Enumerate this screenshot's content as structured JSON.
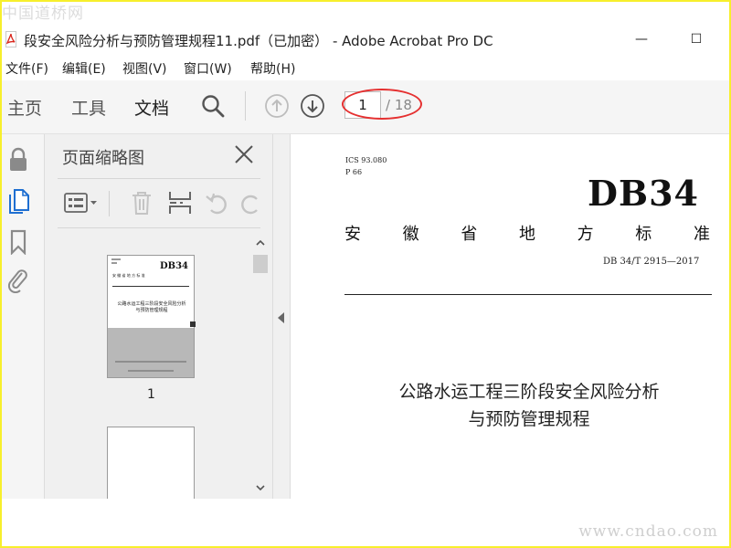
{
  "watermark": {
    "top": "中国道桥网",
    "bottom": "www.cndao.com"
  },
  "window": {
    "title": "段安全风险分析与预防管理规程11.pdf（已加密） - Adobe Acrobat Pro DC",
    "minimize": "—",
    "maximize": "☐"
  },
  "menu": [
    "文件(F)",
    "编辑(E)",
    "视图(V)",
    "窗口(W)",
    "帮助(H)"
  ],
  "toolbar": {
    "tabs": [
      "主页",
      "工具",
      "文档"
    ],
    "page_current": "1",
    "page_total": "/ 18"
  },
  "colors": {
    "annotation": "#e53030",
    "acrobat_red": "#d9261c",
    "nav_blue": "#1f6fd1"
  },
  "panel": {
    "title": "页面缩略图",
    "thumbnail_label": "1",
    "thumb": {
      "code": "DB34",
      "subtitle": "安 徽 省 地 方 标 准",
      "title_line1": "公路水运工程三阶段安全风险分析",
      "title_line2": "与预防管理规程"
    }
  },
  "document": {
    "ics": "ICS 93.080",
    "p": "P 66",
    "code": "DB34",
    "subtitle_chars": [
      "安",
      "徽",
      "省",
      "地",
      "方",
      "标",
      "准"
    ],
    "std_no": "DB 34/T 2915—2017",
    "title_line1": "公路水运工程三阶段安全风险分析",
    "title_line2": "与预防管理规程"
  }
}
